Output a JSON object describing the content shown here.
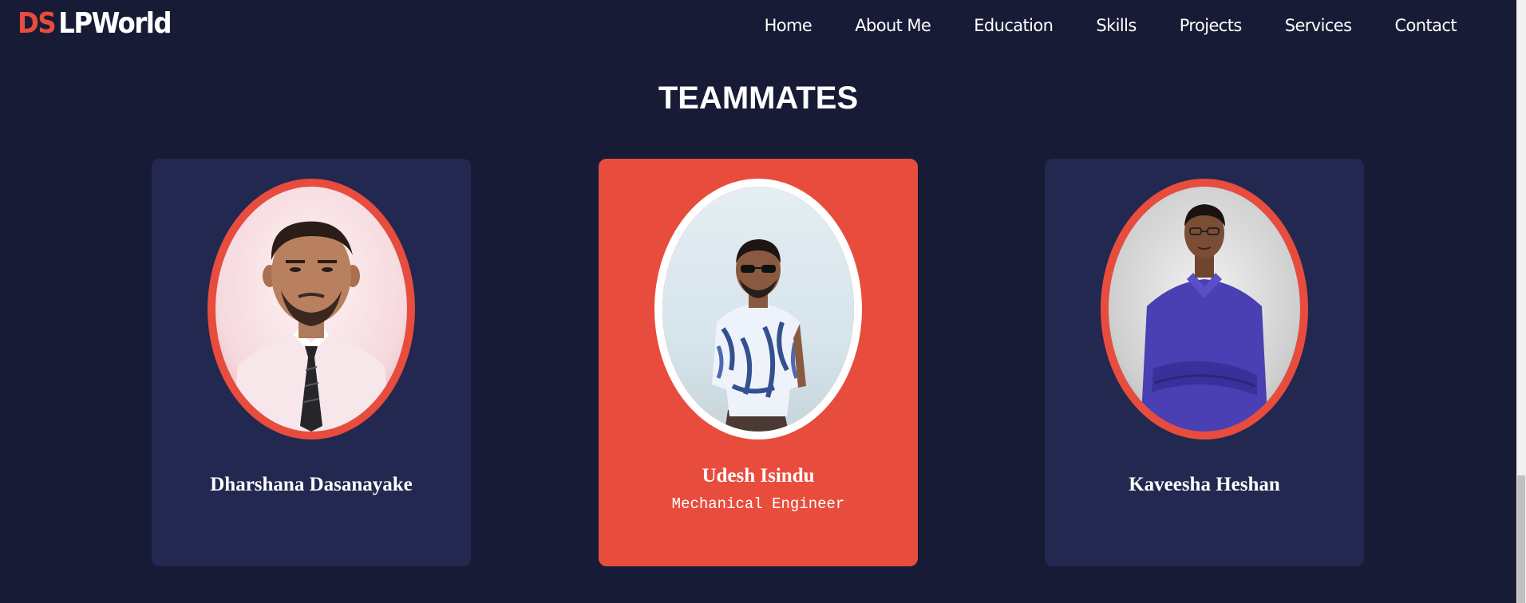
{
  "header": {
    "logo_accent": "DS",
    "logo_main": "LPWorld",
    "nav": [
      "Home",
      "About Me",
      "Education",
      "Skills",
      "Projects",
      "Services",
      "Contact"
    ]
  },
  "section": {
    "title": "TEAMMATES"
  },
  "teammates": [
    {
      "name": "Dharshana Dasanayake",
      "role": "",
      "highlighted": false
    },
    {
      "name": "Udesh Isindu",
      "role": "Mechanical Engineer",
      "highlighted": true
    },
    {
      "name": "Kaveesha Heshan",
      "role": "",
      "highlighted": false
    }
  ],
  "colors": {
    "background": "#181b36",
    "card": "#22284f",
    "accent": "#e84c3d",
    "text": "#ffffff"
  }
}
